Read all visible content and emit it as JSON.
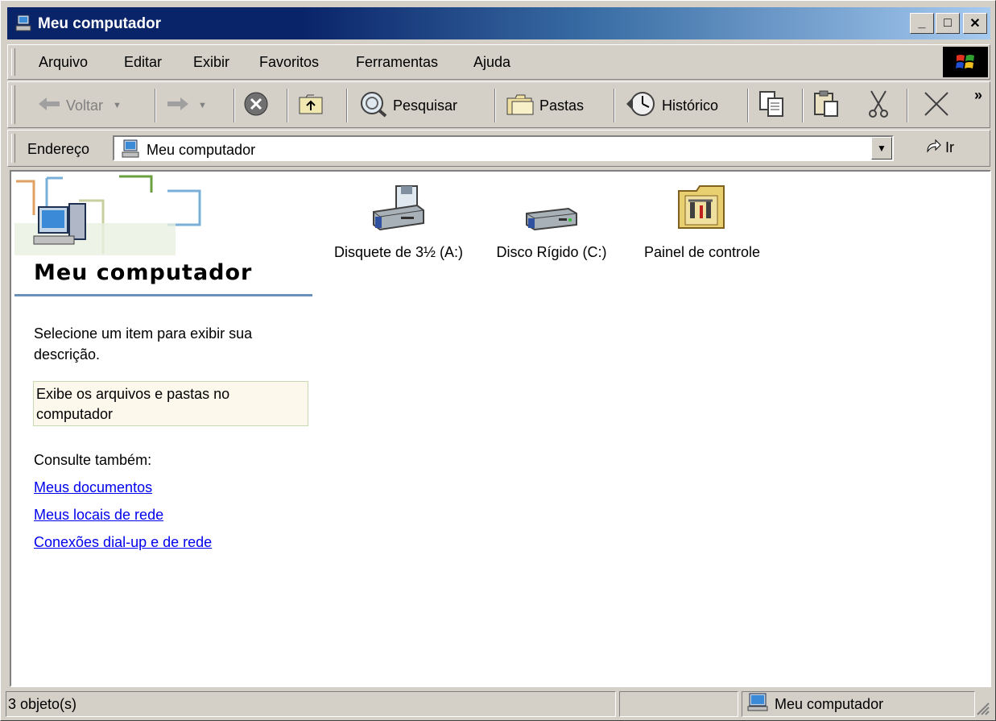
{
  "window": {
    "title": "Meu computador"
  },
  "title_buttons": {
    "minimize": "_",
    "maximize": "□",
    "close": "✕"
  },
  "menu": [
    "Arquivo",
    "Editar",
    "Exibir",
    "Favoritos",
    "Ferramentas",
    "Ajuda"
  ],
  "toolbar": {
    "back_label": "Voltar",
    "search_label": "Pesquisar",
    "folders_label": "Pastas",
    "history_label": "Histórico",
    "overflow": "»"
  },
  "address": {
    "label": "Endereço",
    "value": "Meu computador",
    "go_label": "Ir"
  },
  "left_panel": {
    "title": "Meu computador",
    "description": "Selecione um item para exibir sua descrição.",
    "info": "Exibe os arquivos e pastas no computador",
    "see_also": "Consulte também:",
    "links": [
      "Meus documentos",
      "Meus locais de rede",
      "Conexões dial-up e de rede"
    ]
  },
  "items": [
    {
      "label": "Disquete de 3½ (A:)",
      "icon": "floppy-drive-icon"
    },
    {
      "label": "Disco Rígido (C:)",
      "icon": "hard-drive-icon"
    },
    {
      "label": "Painel de controle",
      "icon": "control-panel-icon"
    }
  ],
  "status": {
    "count": "3 objeto(s)",
    "location": "Meu computador"
  },
  "colors": {
    "title_start": "#0a246a",
    "title_end": "#a6caf0",
    "face": "#d4d0c8",
    "link": "#0000ee",
    "rule": "#6a8fb8"
  }
}
